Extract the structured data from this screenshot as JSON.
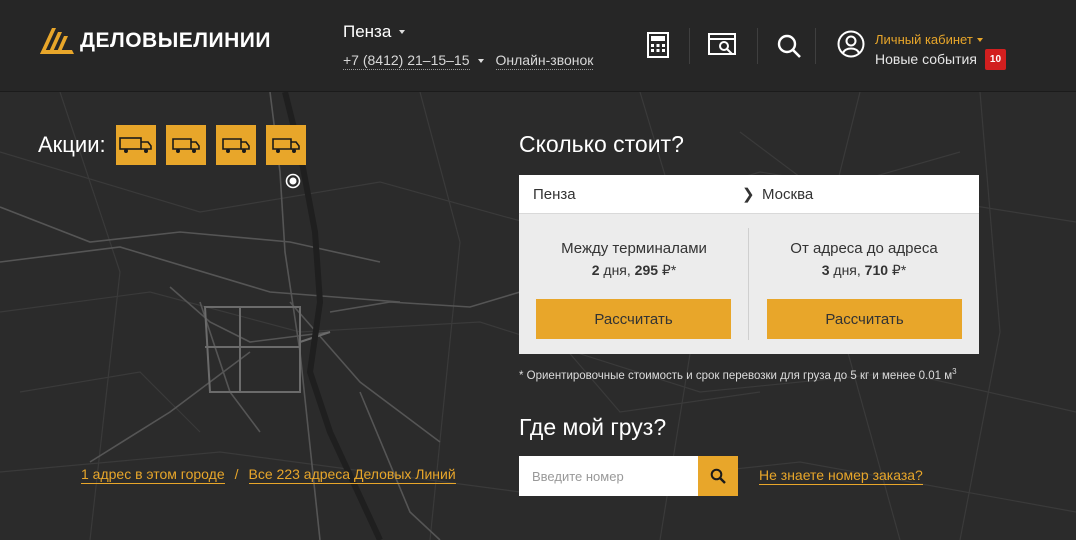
{
  "header": {
    "logo_text": "ДЕЛОВЫЕЛИНИИ",
    "city": "Пенза",
    "phone": "+7 (8412) 21–15–15",
    "online_call": "Онлайн-звонок",
    "icons": [
      "calculator-icon",
      "document-search-icon",
      "search-icon",
      "user-icon"
    ],
    "account": {
      "title": "Личный кабинет",
      "events_label": "Новые события",
      "events_count": "10"
    }
  },
  "promo": {
    "label": "Акции:",
    "items": [
      "truck-icon",
      "van-icon",
      "van-icon",
      "van-icon"
    ]
  },
  "addresses": {
    "city_link": "1 адрес в этом городе",
    "separator": "/",
    "all_link": "Все 223 адреса Деловых Линий"
  },
  "calculator": {
    "title": "Сколько стоит?",
    "from": "Пенза",
    "arrow": "❯",
    "to": "Москва",
    "options": [
      {
        "title": "Между терминалами",
        "days": "2",
        "days_unit": "дня,",
        "price": "295",
        "currency": "₽*",
        "button": "Рассчитать"
      },
      {
        "title": "От адреса до адреса",
        "days": "3",
        "days_unit": "дня,",
        "price": "710",
        "currency": "₽*",
        "button": "Рассчитать"
      }
    ],
    "footnote": "* Ориентировочные стоимость и срок перевозки для груза до 5 кг и менее 0.01 м",
    "footnote_sup": "3"
  },
  "tracking": {
    "title": "Где мой груз?",
    "placeholder": "Введите номер",
    "help_link": "Не знаете номер заказа?"
  },
  "colors": {
    "accent": "#e8a62a",
    "header_bg": "#262626",
    "map_bg": "#2b2b2b",
    "badge": "#d21f1f"
  }
}
